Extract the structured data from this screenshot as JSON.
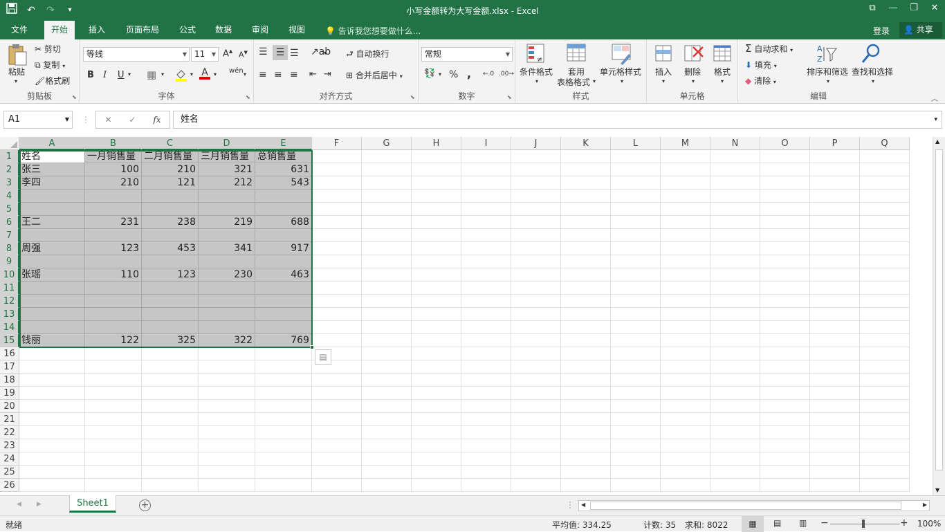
{
  "window": {
    "title": "小写金额转为大写金额.xlsx - Excel",
    "qat": [
      "save-icon",
      "undo-icon",
      "redo-icon",
      "customize-icon"
    ],
    "controls": [
      "ribbon-display-icon",
      "minimize-icon",
      "restore-icon",
      "close-icon"
    ]
  },
  "tabs": [
    "文件",
    "开始",
    "插入",
    "页面布局",
    "公式",
    "数据",
    "审阅",
    "视图"
  ],
  "active_tab": "开始",
  "tell_me": "告诉我您想要做什么...",
  "login": "登录",
  "share": "共享",
  "ribbon": {
    "clipboard": {
      "label": "剪贴板",
      "paste": "粘贴",
      "cut": "剪切",
      "copy": "复制",
      "format_painter": "格式刷"
    },
    "font": {
      "label": "字体",
      "font_name": "等线",
      "font_size": "11",
      "bold": "B",
      "italic": "I",
      "underline": "U",
      "font_color_glyph": "A",
      "phonetic": "wén"
    },
    "alignment": {
      "label": "对齐方式",
      "wrap": "自动换行",
      "merge": "合并后居中"
    },
    "number": {
      "label": "数字",
      "format": "常规",
      "percent": "%",
      "comma": ","
    },
    "styles": {
      "label": "样式",
      "conditional": "条件格式",
      "table_line1": "套用",
      "table_line2": "表格格式",
      "cell_styles": "单元格样式"
    },
    "cells": {
      "label": "单元格",
      "insert": "插入",
      "delete": "删除",
      "format": "格式"
    },
    "editing": {
      "label": "编辑",
      "autosum": "自动求和",
      "fill": "填充",
      "clear": "清除",
      "sort": "排序和筛选",
      "find": "查找和选择"
    }
  },
  "formula_bar": {
    "name_box": "A1",
    "fx": "fx",
    "content": "姓名"
  },
  "columns": [
    "A",
    "B",
    "C",
    "D",
    "E",
    "F",
    "G",
    "H",
    "I",
    "J",
    "K",
    "L",
    "M",
    "N",
    "O",
    "P",
    "Q"
  ],
  "rows": [
    "1",
    "2",
    "3",
    "4",
    "5",
    "6",
    "7",
    "8",
    "9",
    "10",
    "11",
    "12",
    "13",
    "14",
    "15",
    "16",
    "17",
    "18",
    "19",
    "20",
    "21",
    "22",
    "23",
    "24",
    "25",
    "26"
  ],
  "table": [
    [
      "姓名",
      "一月销售量",
      "二月销售量",
      "三月销售量",
      "总销售量"
    ],
    [
      "张三",
      "100",
      "210",
      "321",
      "631"
    ],
    [
      "李四",
      "210",
      "121",
      "212",
      "543"
    ],
    [
      "",
      "",
      "",
      "",
      ""
    ],
    [
      "",
      "",
      "",
      "",
      ""
    ],
    [
      "王二",
      "231",
      "238",
      "219",
      "688"
    ],
    [
      "",
      "",
      "",
      "",
      ""
    ],
    [
      "周强",
      "123",
      "453",
      "341",
      "917"
    ],
    [
      "",
      "",
      "",
      "",
      ""
    ],
    [
      "张瑶",
      "110",
      "123",
      "230",
      "463"
    ],
    [
      "",
      "",
      "",
      "",
      ""
    ],
    [
      "",
      "",
      "",
      "",
      ""
    ],
    [
      "",
      "",
      "",
      "",
      ""
    ],
    [
      "",
      "",
      "",
      "",
      ""
    ],
    [
      "钱丽",
      "122",
      "325",
      "322",
      "769"
    ]
  ],
  "sheet_tab": "Sheet1",
  "status": {
    "ready": "就绪",
    "average": "平均值: 334.25",
    "count": "计数: 35",
    "sum": "求和: 8022",
    "zoom": "100%"
  },
  "colors": {
    "accent": "#217346",
    "selection": "#c6c6c6"
  }
}
